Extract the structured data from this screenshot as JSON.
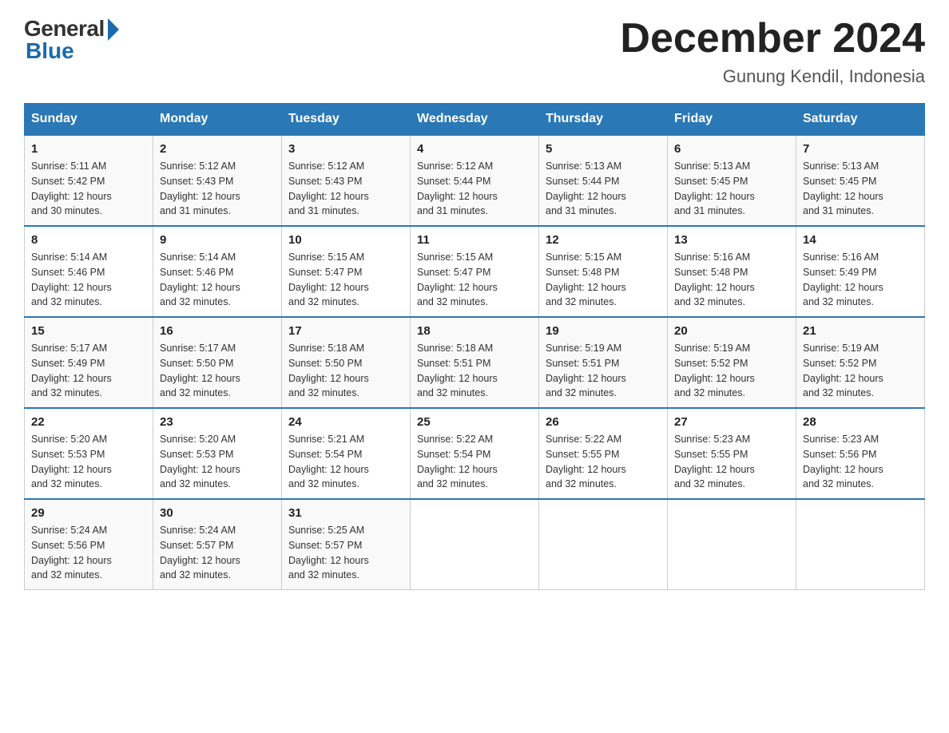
{
  "header": {
    "logo_general": "General",
    "logo_blue": "Blue",
    "month_title": "December 2024",
    "location": "Gunung Kendil, Indonesia"
  },
  "days_of_week": [
    "Sunday",
    "Monday",
    "Tuesday",
    "Wednesday",
    "Thursday",
    "Friday",
    "Saturday"
  ],
  "weeks": [
    [
      {
        "day": "1",
        "sunrise": "5:11 AM",
        "sunset": "5:42 PM",
        "daylight": "12 hours and 30 minutes."
      },
      {
        "day": "2",
        "sunrise": "5:12 AM",
        "sunset": "5:43 PM",
        "daylight": "12 hours and 31 minutes."
      },
      {
        "day": "3",
        "sunrise": "5:12 AM",
        "sunset": "5:43 PM",
        "daylight": "12 hours and 31 minutes."
      },
      {
        "day": "4",
        "sunrise": "5:12 AM",
        "sunset": "5:44 PM",
        "daylight": "12 hours and 31 minutes."
      },
      {
        "day": "5",
        "sunrise": "5:13 AM",
        "sunset": "5:44 PM",
        "daylight": "12 hours and 31 minutes."
      },
      {
        "day": "6",
        "sunrise": "5:13 AM",
        "sunset": "5:45 PM",
        "daylight": "12 hours and 31 minutes."
      },
      {
        "day": "7",
        "sunrise": "5:13 AM",
        "sunset": "5:45 PM",
        "daylight": "12 hours and 31 minutes."
      }
    ],
    [
      {
        "day": "8",
        "sunrise": "5:14 AM",
        "sunset": "5:46 PM",
        "daylight": "12 hours and 32 minutes."
      },
      {
        "day": "9",
        "sunrise": "5:14 AM",
        "sunset": "5:46 PM",
        "daylight": "12 hours and 32 minutes."
      },
      {
        "day": "10",
        "sunrise": "5:15 AM",
        "sunset": "5:47 PM",
        "daylight": "12 hours and 32 minutes."
      },
      {
        "day": "11",
        "sunrise": "5:15 AM",
        "sunset": "5:47 PM",
        "daylight": "12 hours and 32 minutes."
      },
      {
        "day": "12",
        "sunrise": "5:15 AM",
        "sunset": "5:48 PM",
        "daylight": "12 hours and 32 minutes."
      },
      {
        "day": "13",
        "sunrise": "5:16 AM",
        "sunset": "5:48 PM",
        "daylight": "12 hours and 32 minutes."
      },
      {
        "day": "14",
        "sunrise": "5:16 AM",
        "sunset": "5:49 PM",
        "daylight": "12 hours and 32 minutes."
      }
    ],
    [
      {
        "day": "15",
        "sunrise": "5:17 AM",
        "sunset": "5:49 PM",
        "daylight": "12 hours and 32 minutes."
      },
      {
        "day": "16",
        "sunrise": "5:17 AM",
        "sunset": "5:50 PM",
        "daylight": "12 hours and 32 minutes."
      },
      {
        "day": "17",
        "sunrise": "5:18 AM",
        "sunset": "5:50 PM",
        "daylight": "12 hours and 32 minutes."
      },
      {
        "day": "18",
        "sunrise": "5:18 AM",
        "sunset": "5:51 PM",
        "daylight": "12 hours and 32 minutes."
      },
      {
        "day": "19",
        "sunrise": "5:19 AM",
        "sunset": "5:51 PM",
        "daylight": "12 hours and 32 minutes."
      },
      {
        "day": "20",
        "sunrise": "5:19 AM",
        "sunset": "5:52 PM",
        "daylight": "12 hours and 32 minutes."
      },
      {
        "day": "21",
        "sunrise": "5:19 AM",
        "sunset": "5:52 PM",
        "daylight": "12 hours and 32 minutes."
      }
    ],
    [
      {
        "day": "22",
        "sunrise": "5:20 AM",
        "sunset": "5:53 PM",
        "daylight": "12 hours and 32 minutes."
      },
      {
        "day": "23",
        "sunrise": "5:20 AM",
        "sunset": "5:53 PM",
        "daylight": "12 hours and 32 minutes."
      },
      {
        "day": "24",
        "sunrise": "5:21 AM",
        "sunset": "5:54 PM",
        "daylight": "12 hours and 32 minutes."
      },
      {
        "day": "25",
        "sunrise": "5:22 AM",
        "sunset": "5:54 PM",
        "daylight": "12 hours and 32 minutes."
      },
      {
        "day": "26",
        "sunrise": "5:22 AM",
        "sunset": "5:55 PM",
        "daylight": "12 hours and 32 minutes."
      },
      {
        "day": "27",
        "sunrise": "5:23 AM",
        "sunset": "5:55 PM",
        "daylight": "12 hours and 32 minutes."
      },
      {
        "day": "28",
        "sunrise": "5:23 AM",
        "sunset": "5:56 PM",
        "daylight": "12 hours and 32 minutes."
      }
    ],
    [
      {
        "day": "29",
        "sunrise": "5:24 AM",
        "sunset": "5:56 PM",
        "daylight": "12 hours and 32 minutes."
      },
      {
        "day": "30",
        "sunrise": "5:24 AM",
        "sunset": "5:57 PM",
        "daylight": "12 hours and 32 minutes."
      },
      {
        "day": "31",
        "sunrise": "5:25 AM",
        "sunset": "5:57 PM",
        "daylight": "12 hours and 32 minutes."
      },
      null,
      null,
      null,
      null
    ]
  ],
  "labels": {
    "sunrise_prefix": "Sunrise: ",
    "sunset_prefix": "Sunset: ",
    "daylight_prefix": "Daylight: "
  }
}
